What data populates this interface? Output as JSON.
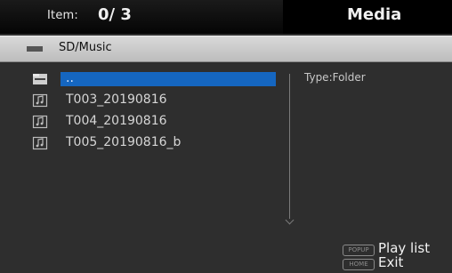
{
  "header": {
    "item_label": "Item:",
    "item_count": "0/ 3",
    "title": "Media"
  },
  "path": {
    "icon": "folder-strip-icon",
    "text": "SD/Music"
  },
  "list": {
    "items": [
      {
        "icon": "folder-up-icon",
        "label": ".."
      },
      {
        "icon": "music-file-icon",
        "label": "T003_20190816"
      },
      {
        "icon": "music-file-icon",
        "label": "T004_20190816"
      },
      {
        "icon": "music-file-icon",
        "label": "T005_20190816_b"
      }
    ]
  },
  "info": {
    "type_text": "Type:Folder"
  },
  "keys": {
    "popup_badge": "POPUP",
    "popup_label": "Play list",
    "home_badge": "HOME",
    "home_label": "Exit"
  },
  "colors": {
    "selection": "#1566c0",
    "background": "#2e2e2e",
    "pathbar": "#cfcfcf"
  }
}
